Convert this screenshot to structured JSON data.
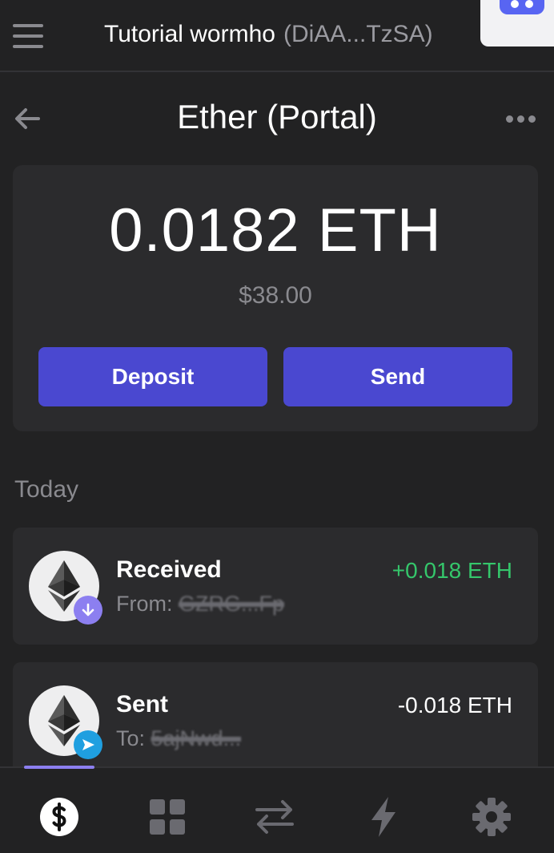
{
  "header": {
    "wallet_name": "Tutorial wormho",
    "wallet_address": "(DiAA...TzSA)"
  },
  "token": {
    "title": "Ether (Portal)",
    "balance": "0.0182 ETH",
    "balance_usd": "$38.00"
  },
  "actions": {
    "deposit_label": "Deposit",
    "send_label": "Send"
  },
  "activity": {
    "section_label": "Today",
    "transactions": [
      {
        "type": "Received",
        "party_prefix": "From:",
        "party_value": "GZRG...Fp",
        "amount": "+0.018 ETH",
        "badge_icon": "arrow-down-icon"
      },
      {
        "type": "Sent",
        "party_prefix": "To:",
        "party_value": "5ajNwd...",
        "amount": "-0.018 ETH",
        "badge_icon": "send-icon"
      }
    ]
  },
  "nav": {
    "active": "balances",
    "items": [
      "dollar-icon",
      "grid-icon",
      "swap-icon",
      "lightning-icon",
      "gear-icon"
    ]
  },
  "colors": {
    "background": "#222223",
    "card": "#2b2b2d",
    "accent": "#4a48d0",
    "positive": "#35c66b",
    "nav_indicator": "#8c7ff0",
    "received_badge": "#8c7ff0",
    "sent_badge": "#1f9fe0"
  }
}
